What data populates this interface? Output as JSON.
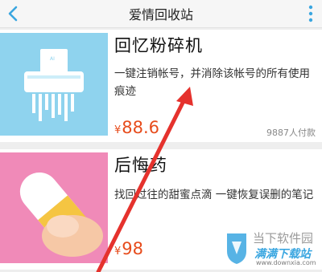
{
  "header": {
    "title": "爱情回收站"
  },
  "cards": [
    {
      "title": "回忆粉碎机",
      "description": "一键注销帐号，并消除该帐号的所有使用痕迹",
      "currency": "¥",
      "price": "88.6",
      "buyers": "9887人付款"
    },
    {
      "title": "后悔药",
      "description": "找回过往的甜蜜点滴 一键恢复误删的笔记",
      "currency": "¥",
      "price": "98"
    }
  ],
  "watermark": {
    "line1": "当下软件园",
    "line2": "满满下载站",
    "line3": "www.downxia.com"
  },
  "colors": {
    "accent": "#e74c1c",
    "header_icon": "#3aa6e0",
    "thumb1_bg": "#8fd3ee",
    "thumb2_bg": "#f08ab8",
    "arrow": "#e5322d"
  }
}
